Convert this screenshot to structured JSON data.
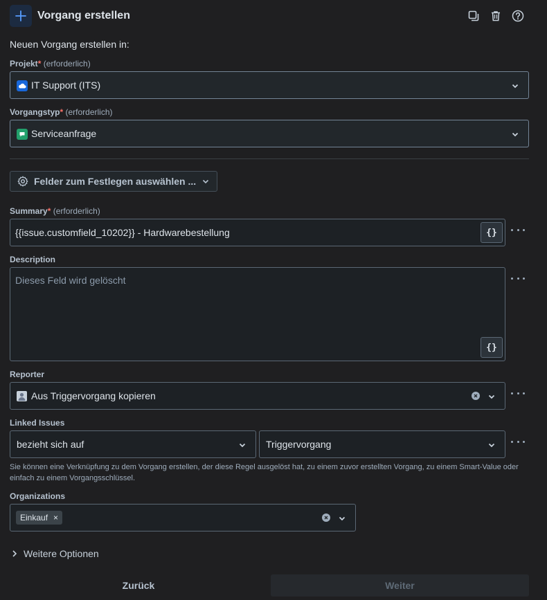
{
  "header": {
    "title": "Vorgang erstellen",
    "icon": "plus-icon",
    "actions": [
      "duplicate-icon",
      "trash-icon",
      "help-icon"
    ]
  },
  "subtitle": "Neuen Vorgang erstellen in:",
  "required_mark": "*",
  "required_text": "(erforderlich)",
  "project": {
    "label": "Projekt",
    "value": "IT Support (ITS)",
    "icon": "cloud-project-icon"
  },
  "issue_type": {
    "label": "Vorgangstyp",
    "value": "Serviceanfrage",
    "icon": "service-request-icon"
  },
  "fields_button": {
    "label": "Felder zum Festlegen auswählen ..."
  },
  "summary": {
    "label": "Summary",
    "value": "{{issue.customfield_10202}} - Hardwarebestellung",
    "smart_label": "{}"
  },
  "description": {
    "label": "Description",
    "placeholder": "Dieses Feld wird gelöscht",
    "smart_label": "{}"
  },
  "reporter": {
    "label": "Reporter",
    "value": "Aus Triggervorgang kopieren",
    "icon": "user-avatar-icon"
  },
  "linked_issues": {
    "label": "Linked Issues",
    "relation": "bezieht sich auf",
    "target": "Triggervorgang",
    "help": "Sie können eine Verknüpfung zu dem Vorgang erstellen, der diese Regel ausgelöst hat, zu einem zuvor erstellten Vorgang, zu einem Smart-Value oder einfach zu einem Vorgangsschlüssel."
  },
  "organizations": {
    "label": "Organizations",
    "tags": [
      "Einkauf"
    ],
    "remove_glyph": "×"
  },
  "more_options": {
    "label": "Weitere Optionen"
  },
  "footer": {
    "back": "Zurück",
    "next": "Weiter"
  },
  "colors": {
    "background": "#1f1f21",
    "required": "#f87168",
    "accent": "#579dff"
  }
}
